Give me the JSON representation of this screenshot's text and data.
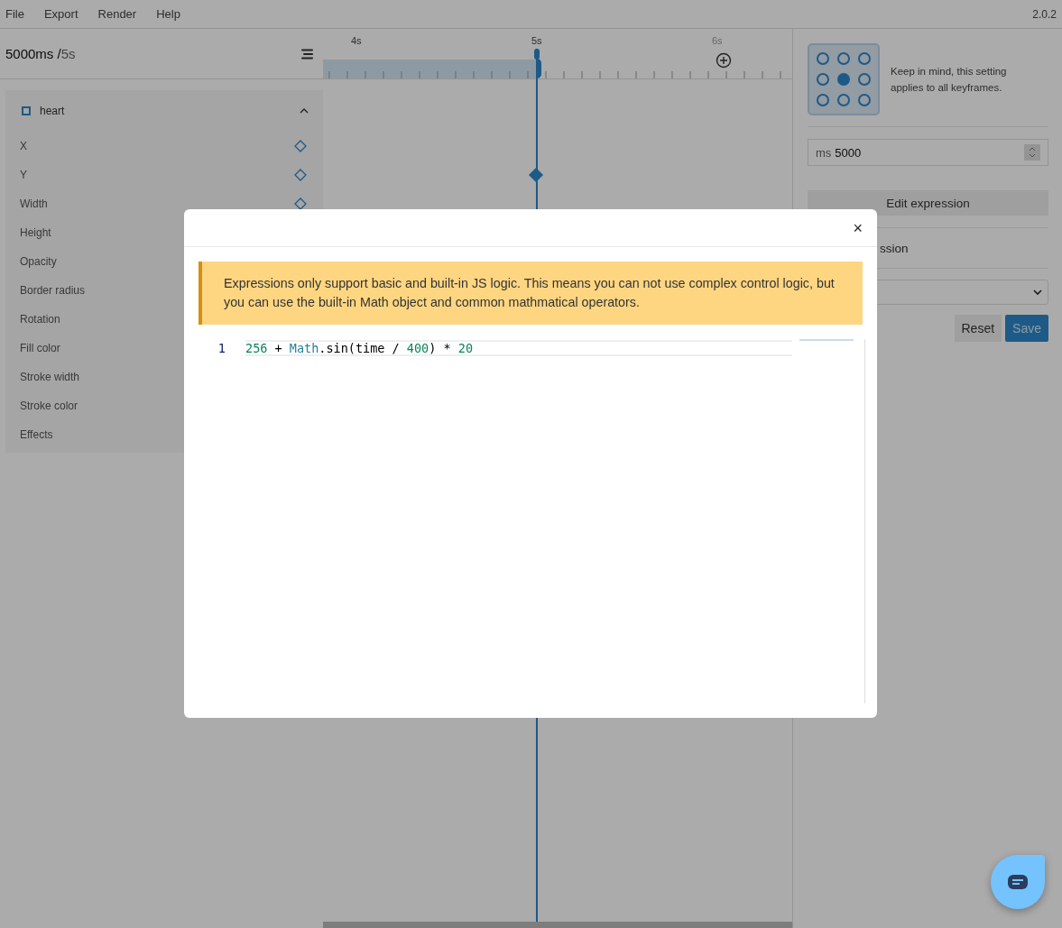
{
  "menu": [
    "File",
    "Export",
    "Render",
    "Help"
  ],
  "version": "2.0.2",
  "time": {
    "current": "5000ms /",
    "total": "5s"
  },
  "timeline": {
    "ticks": [
      {
        "label": "4s",
        "dimmed": false
      },
      {
        "label": "5s",
        "dimmed": false
      },
      {
        "label": "6s",
        "dimmed": true
      }
    ]
  },
  "layer": {
    "name": "heart",
    "expanded": true
  },
  "properties": [
    {
      "name": "X",
      "keyframe_button": true,
      "keyframe_at_playhead": false
    },
    {
      "name": "Y",
      "keyframe_button": true,
      "keyframe_at_playhead": true
    },
    {
      "name": "Width",
      "keyframe_button": true,
      "keyframe_at_playhead": false
    },
    {
      "name": "Height"
    },
    {
      "name": "Opacity"
    },
    {
      "name": "Border radius"
    },
    {
      "name": "Rotation"
    },
    {
      "name": "Fill color"
    },
    {
      "name": "Stroke width"
    },
    {
      "name": "Stroke color"
    },
    {
      "name": "Effects"
    }
  ],
  "inspector": {
    "anchor_points": [
      {
        "selected": false
      },
      {
        "selected": false
      },
      {
        "selected": false
      },
      {
        "selected": false
      },
      {
        "selected": true
      },
      {
        "selected": false
      },
      {
        "selected": false
      },
      {
        "selected": false
      },
      {
        "selected": false
      }
    ],
    "anchor_note": "Keep in mind, this setting applies to all keyframes.",
    "time_field": {
      "unit": "ms",
      "value": "5000"
    },
    "edit_button": "Edit expression",
    "partial_row": "ssion",
    "reset_button": "Reset",
    "save_button": "Save"
  },
  "modal": {
    "alert": "Expressions only support basic and built-in JS logic. This means you can not use complex control logic, but you can use the built-in Math object and common mathmatical operators.",
    "close": "×",
    "lines": [
      {
        "number": "1",
        "tokens": [
          {
            "kind": "number",
            "text": "256"
          },
          {
            "kind": "plain",
            "text": " + "
          },
          {
            "kind": "class",
            "text": "Math"
          },
          {
            "kind": "plain",
            "text": ".sin(time / "
          },
          {
            "kind": "number",
            "text": "400"
          },
          {
            "kind": "plain",
            "text": ") * "
          },
          {
            "kind": "number",
            "text": "20"
          }
        ]
      }
    ]
  }
}
